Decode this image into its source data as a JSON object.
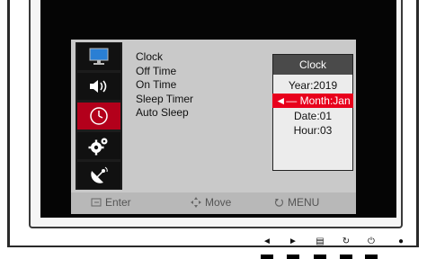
{
  "osd": {
    "menu_items": [
      "Clock",
      "Off Time",
      "On Time",
      "Sleep Timer",
      "Auto Sleep"
    ],
    "icons": [
      "monitor-icon",
      "speaker-icon",
      "clock-icon",
      "gear-icon",
      "satellite-dish-icon"
    ],
    "active_tab": "clock-icon"
  },
  "clock_panel": {
    "title": "Clock",
    "year": "Year:2019",
    "month": "◄— Month:Jan —►",
    "date": "Date:01",
    "hour": "Hour:03"
  },
  "hints": {
    "enter": "Enter",
    "move": "Move",
    "menu": "MENU"
  },
  "controls": {
    "left": "◄",
    "right": "►",
    "source": "▤",
    "auto": "↻",
    "power": "⏻",
    "led": "●"
  },
  "colors": {
    "accent": "#e8001c",
    "active_tab": "#b3001b",
    "osd_bg": "#c9c9c9",
    "panel_header": "#4a4a4a"
  }
}
